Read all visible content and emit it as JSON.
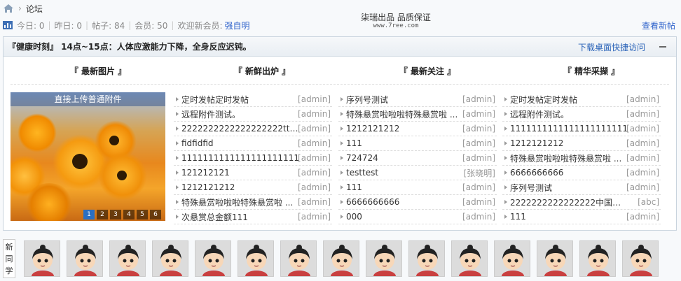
{
  "breadcrumb": {
    "home_icon": "home-icon",
    "current": "论坛"
  },
  "brand": {
    "main": "柒瑞出品  品质保证",
    "sub": "www.7ree.com"
  },
  "stats": {
    "today": "今日: 0",
    "yesterday": "昨日: 0",
    "posts": "帖子: 84",
    "members": "会员: 50",
    "welcome": "欢迎新会员:",
    "newest_member": "强自明"
  },
  "view_new_label": "查看新帖",
  "panel": {
    "headline": "『健康时刻』 14点~15点：人体应激能力下降，全身反应迟钝。",
    "download_link": "下载桌面快捷访问",
    "columns": [
      "『 最新图片 』",
      "『 新鲜出炉 』",
      "『 最新关注 』",
      "『 精华采撷 』"
    ],
    "slide_caption": "直接上传普通附件",
    "slide_nav": [
      "1",
      "2",
      "3",
      "4",
      "5",
      "6"
    ],
    "new_posts": [
      {
        "title": "定时发帖定时发帖",
        "author": "[admin]"
      },
      {
        "title": "远程附件测试。",
        "author": "[admin]"
      },
      {
        "title": "2222222222222222222tttt ...",
        "author": "[admin]"
      },
      {
        "title": "fidfidfid",
        "author": "[admin]"
      },
      {
        "title": "1111111111111111111111",
        "author": "[admin]"
      },
      {
        "title": "121212121",
        "author": "[admin]"
      },
      {
        "title": "1212121212",
        "author": "[admin]"
      },
      {
        "title": "特殊悬赏啦啦啦特殊悬赏啦 ...",
        "author": "[admin]"
      },
      {
        "title": "次悬赏总金额111",
        "author": "[admin]"
      }
    ],
    "hot_posts": [
      {
        "title": "序列号测试",
        "author": "[admin]"
      },
      {
        "title": "特殊悬赏啦啦啦特殊悬赏啦 ...",
        "author": "[admin]"
      },
      {
        "title": "1212121212",
        "author": "[admin]"
      },
      {
        "title": "111",
        "author": "[admin]"
      },
      {
        "title": "724724",
        "author": "[admin]"
      },
      {
        "title": "testtest",
        "author": "[张晓明]"
      },
      {
        "title": "111",
        "author": "[admin]"
      },
      {
        "title": "6666666666",
        "author": "[admin]"
      },
      {
        "title": "000",
        "author": "[admin]"
      }
    ],
    "digest_posts": [
      {
        "title": "定时发帖定时发帖",
        "author": "[admin]"
      },
      {
        "title": "远程附件测试。",
        "author": "[admin]"
      },
      {
        "title": "1111111111111111111111",
        "author": "[admin]"
      },
      {
        "title": "1212121212",
        "author": "[admin]"
      },
      {
        "title": "特殊悬赏啦啦啦特殊悬赏啦 ...",
        "author": "[admin]"
      },
      {
        "title": "6666666666",
        "author": "[admin]"
      },
      {
        "title": "序列号测试",
        "author": "[admin]"
      },
      {
        "title": "2222222222222222中国哦你 ...",
        "author": "[abc]"
      },
      {
        "title": "111",
        "author": "[admin]"
      }
    ]
  },
  "new_members": {
    "label": "新同学",
    "count": 15
  },
  "colors": {
    "link": "#3366cc",
    "accent": "#2b6fc2"
  }
}
